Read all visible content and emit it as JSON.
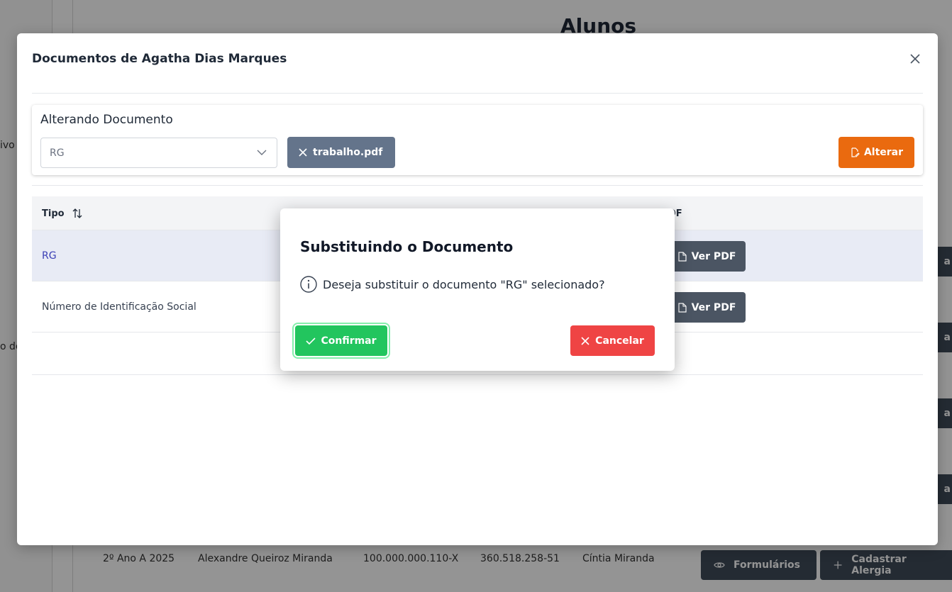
{
  "background": {
    "page_title": "Alunos",
    "sidebar_fragments": [
      "ivo",
      "o de"
    ],
    "row": {
      "turma": "2º Ano A 2025",
      "nome": "Alexandre Queiroz Miranda",
      "codigo": "100.000.000.110-X",
      "cpf": "360.518.258-51",
      "responsavel": "Cíntia Miranda"
    },
    "buttons": {
      "formularios": "Formulários",
      "cadastrar_alergia": "Cadastrar Alergia"
    },
    "side_button_fragment": "a"
  },
  "documents_dialog": {
    "title": "Documentos de Agatha Dias Marques",
    "edit_card": {
      "heading": "Alterando Documento",
      "select_value": "RG",
      "file_name": "trabalho.pdf",
      "alter_label": "Alterar"
    },
    "table": {
      "headers": {
        "tipo": "Tipo",
        "pdf": "DF"
      },
      "rows": [
        {
          "tipo": "RG",
          "pdf_label": "Ver PDF"
        },
        {
          "tipo": "Número de Identificação Social",
          "pdf_label": "Ver PDF"
        }
      ]
    }
  },
  "confirm_dialog": {
    "title": "Substituindo o Documento",
    "message": "Deseja substituir o documento \"RG\" selecionado?",
    "confirm_label": "Confirmar",
    "cancel_label": "Cancelar"
  },
  "colors": {
    "confirm": "#22c55e",
    "cancel": "#ef4444",
    "alter": "#ea6a0f",
    "file_chip": "#64748b",
    "pdf_button": "#4b5563"
  }
}
